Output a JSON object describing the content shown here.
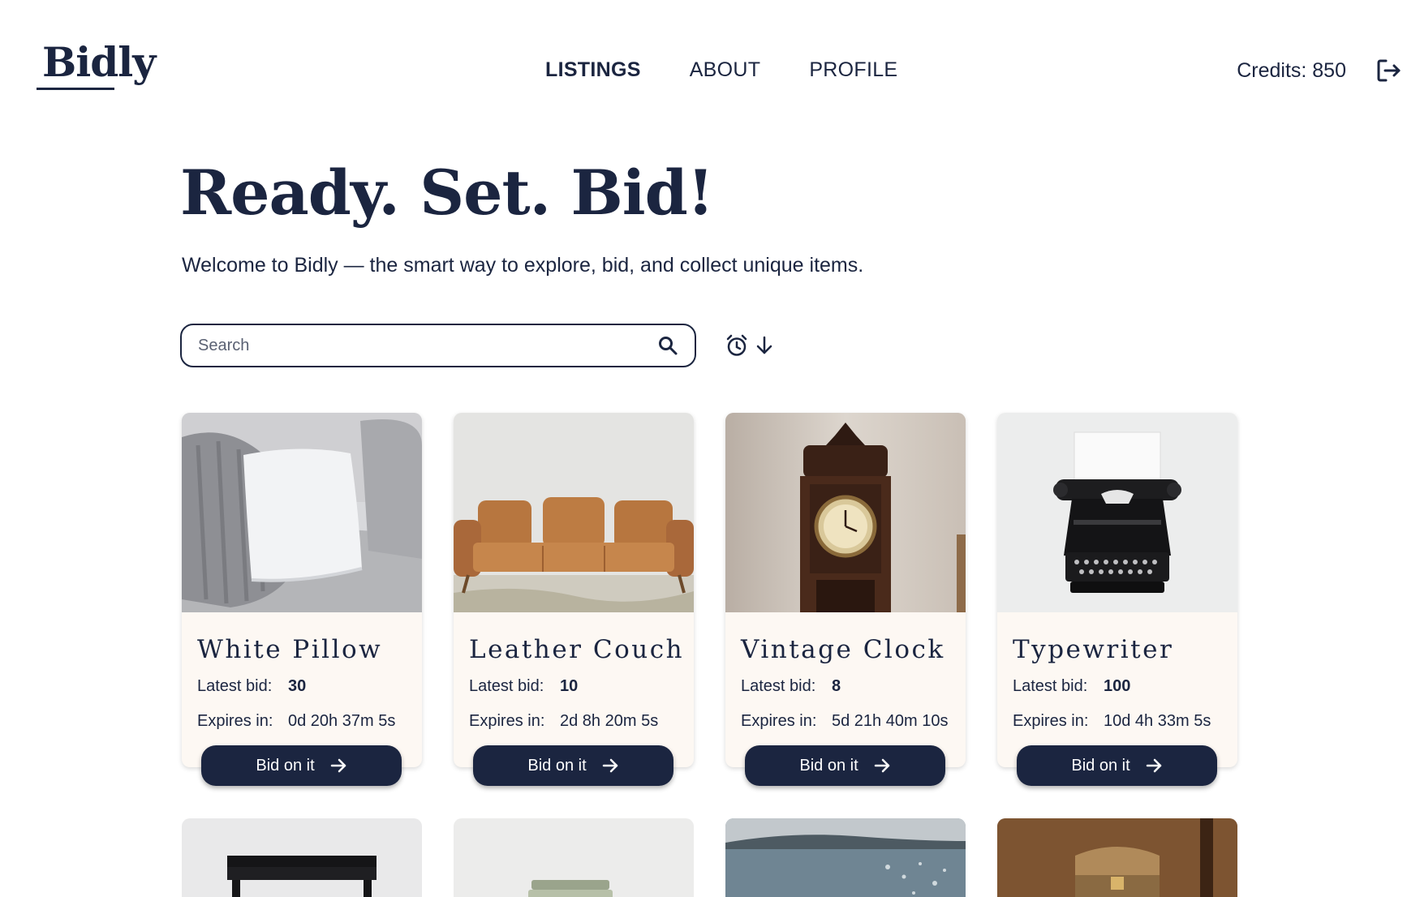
{
  "header": {
    "logo": "Bidly",
    "nav": [
      {
        "label": "LISTINGS",
        "active": true
      },
      {
        "label": "ABOUT",
        "active": false
      },
      {
        "label": "PROFILE",
        "active": false
      }
    ],
    "credits": "Credits: 850",
    "logout_icon": "logout-icon"
  },
  "hero": {
    "title": "Ready. Set. Bid!",
    "subtitle": "Welcome to Bidly — the smart way to explore, bid, and collect unique items."
  },
  "search": {
    "placeholder": "Search",
    "value": "",
    "icon": "search-icon"
  },
  "sort": {
    "icons": [
      "alarm-clock-icon",
      "arrow-down-icon"
    ]
  },
  "listings": [
    {
      "title": "White Pillow",
      "bid_label": "Latest bid:",
      "bid": "30",
      "expires_label": "Expires in:",
      "expires": "0d 20h 37m 5s",
      "button": "Bid on it",
      "image": "white-pillow-photo"
    },
    {
      "title": "Leather Couch",
      "bid_label": "Latest bid:",
      "bid": "10",
      "expires_label": "Expires in:",
      "expires": "2d 8h 20m 5s",
      "button": "Bid on it",
      "image": "leather-couch-photo"
    },
    {
      "title": "Vintage Clock",
      "bid_label": "Latest bid:",
      "bid": "8",
      "expires_label": "Expires in:",
      "expires": "5d 21h 40m 10s",
      "button": "Bid on it",
      "image": "vintage-clock-photo"
    },
    {
      "title": "Typewriter",
      "bid_label": "Latest bid:",
      "bid": "100",
      "expires_label": "Expires in:",
      "expires": "10d 4h 33m 5s",
      "button": "Bid on it",
      "image": "typewriter-photo"
    }
  ],
  "more_listings_images": [
    "piano-photo",
    "books-photo",
    "sea-photo",
    "treasure-chest-photo"
  ],
  "colors": {
    "primary": "#1b2540",
    "card_bg": "#fdf8f3"
  }
}
